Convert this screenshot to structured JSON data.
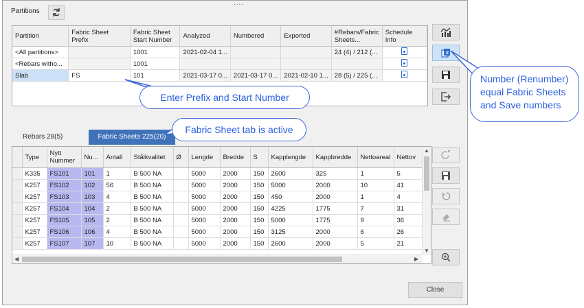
{
  "partitions_tab": "Partitions",
  "partition_table": {
    "headers": [
      "Partition",
      "Fabric Sheet Prefix",
      "Fabric Sheet Start Number",
      "Analyzed",
      "Numbered",
      "Exported",
      "#Rebars/Fabric Sheets...",
      "Schedule Info"
    ],
    "rows": [
      {
        "partition": "<All partitions>",
        "prefix": "",
        "start": "1001",
        "analyzed": "2021-02-04 1...",
        "numbered": "",
        "exported": "",
        "counts": "24 (4) / 212 (..."
      },
      {
        "partition": "<Rebars witho...",
        "prefix": "",
        "start": "1001",
        "analyzed": "",
        "numbered": "",
        "exported": "",
        "counts": ""
      },
      {
        "partition": "Slab",
        "prefix": "FS",
        "start": "101",
        "analyzed": "2021-03-17 0...",
        "numbered": "2021-03-17 0...",
        "exported": "2021-02-10 1...",
        "counts": "28 (5) / 225 (..."
      }
    ]
  },
  "tabs": {
    "rebars": "Rebars 28(5)",
    "fabric": "Fabric Sheets 225(20)"
  },
  "grid": {
    "headers": [
      "",
      "Type",
      "Nytt Nummer",
      "Nu...",
      "Antall",
      "Stålkvalitet",
      "Ø",
      "Lengde",
      "Bredde",
      "S",
      "Kapplengde",
      "Kappbredde",
      "Nettoareal",
      "Nettov"
    ],
    "rows": [
      [
        "",
        "K335",
        "FS101",
        "101",
        "1",
        "B 500 NA",
        "",
        "5000",
        "2000",
        "150",
        "2600",
        "325",
        "1",
        "5"
      ],
      [
        "",
        "K257",
        "FS102",
        "102",
        "56",
        "B 500 NA",
        "",
        "5000",
        "2000",
        "150",
        "5000",
        "2000",
        "10",
        "41"
      ],
      [
        "",
        "K257",
        "FS103",
        "103",
        "4",
        "B 500 NA",
        "",
        "5000",
        "2000",
        "150",
        "450",
        "2000",
        "1",
        "4"
      ],
      [
        "",
        "K257",
        "FS104",
        "104",
        "2",
        "B 500 NA",
        "",
        "5000",
        "2000",
        "150",
        "4225",
        "1775",
        "7",
        "31"
      ],
      [
        "",
        "K257",
        "FS105",
        "105",
        "2",
        "B 500 NA",
        "",
        "5000",
        "2000",
        "150",
        "5000",
        "1775",
        "9",
        "36"
      ],
      [
        "",
        "K257",
        "FS106",
        "106",
        "4",
        "B 500 NA",
        "",
        "5000",
        "2000",
        "150",
        "3125",
        "2000",
        "6",
        "26"
      ],
      [
        "",
        "K257",
        "FS107",
        "107",
        "10",
        "B 500 NA",
        "",
        "5000",
        "2000",
        "150",
        "2600",
        "2000",
        "5",
        "21"
      ]
    ]
  },
  "close_label": "Close",
  "callouts": {
    "prefix": "Enter Prefix and  Start Number",
    "tab_active": "Fabric Sheet tab is active",
    "renumber": [
      "Number (Renumber)",
      "equal Fabric Sheets",
      "and Save numbers"
    ]
  },
  "colors": {
    "accent": "#3f72b8",
    "highlight": "#b8b8f0",
    "callout": "#2a5fe0"
  }
}
